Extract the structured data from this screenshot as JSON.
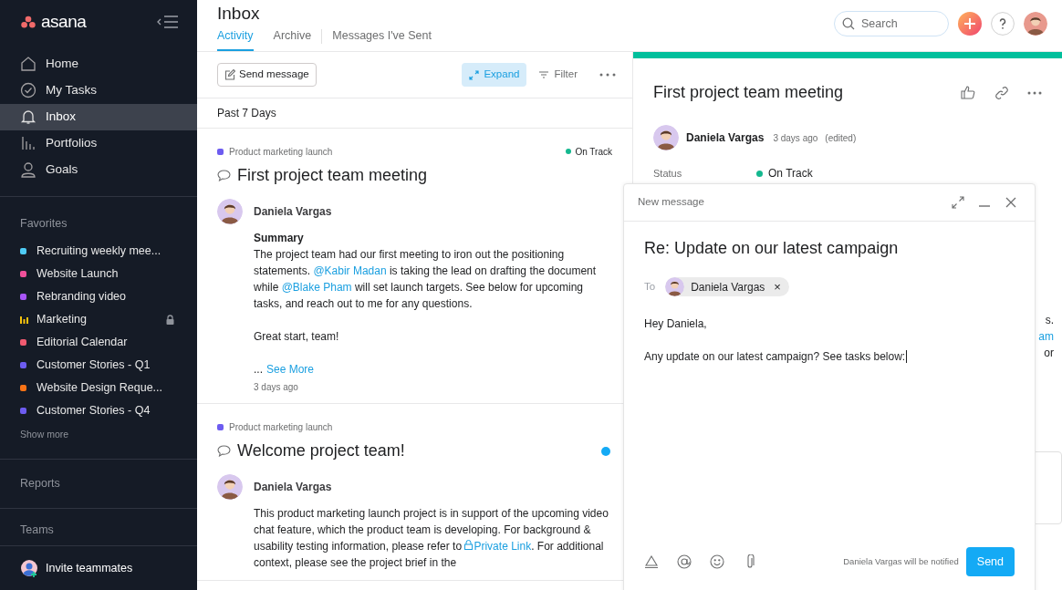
{
  "sidebar": {
    "logo": "asana",
    "nav": [
      {
        "label": "Home",
        "selected": false
      },
      {
        "label": "My Tasks",
        "selected": false
      },
      {
        "label": "Inbox",
        "selected": true
      },
      {
        "label": "Portfolios",
        "selected": false
      },
      {
        "label": "Goals",
        "selected": false
      }
    ],
    "favorites_heading": "Favorites",
    "favorites": [
      {
        "label": "Recruiting weekly mee...",
        "kind": "dot",
        "color": "#4ecbf5",
        "locked": false
      },
      {
        "label": "Website Launch",
        "kind": "dot",
        "color": "#f0509a",
        "locked": false
      },
      {
        "label": "Rebranding video",
        "kind": "dot",
        "color": "#a855f7",
        "locked": false
      },
      {
        "label": "Marketing",
        "kind": "chart",
        "color": "#f8c30d",
        "locked": true
      },
      {
        "label": "Editorial Calendar",
        "kind": "dot",
        "color": "#f05a70",
        "locked": false
      },
      {
        "label": "Customer Stories - Q1",
        "kind": "dot",
        "color": "#6d5cf0",
        "locked": false
      },
      {
        "label": "Website Design Reque...",
        "kind": "dot",
        "color": "#f97316",
        "locked": false
      },
      {
        "label": "Customer Stories - Q4",
        "kind": "dot",
        "color": "#6d5cf0",
        "locked": false
      }
    ],
    "show_more": "Show more",
    "reports": "Reports",
    "teams": "Teams",
    "invite": "Invite teammates"
  },
  "header": {
    "title": "Inbox",
    "tabs": [
      {
        "label": "Activity",
        "selected": true
      },
      {
        "label": "Archive",
        "selected": false
      },
      {
        "label": "Messages I've Sent",
        "selected": false
      }
    ],
    "search": {
      "placeholder": "Search"
    }
  },
  "toolbar": {
    "send_message": "Send message",
    "expand": {
      "label": "Expand",
      "selected": true
    },
    "filter": "Filter"
  },
  "period": "Past 7 Days",
  "feed": [
    {
      "project": "Product marketing launch",
      "status": {
        "label": "On Track",
        "color": "#14b88f"
      },
      "unread": false,
      "title": "First project team meeting",
      "author": "Daniela Vargas",
      "heading": "Summary",
      "paragraphs": [
        [
          {
            "kind": "text",
            "text": "The project team had our first meeting to iron out the positioning statements. "
          },
          {
            "kind": "mention",
            "text": "@Kabir Madan"
          },
          {
            "kind": "text",
            "text": " is taking the lead on drafting the document while "
          },
          {
            "kind": "mention",
            "text": "@Blake Pham"
          },
          {
            "kind": "text",
            "text": " will set launch targets. See below for upcoming tasks, and reach out to me for any questions."
          }
        ],
        [
          {
            "kind": "text",
            "text": "Great start, team!"
          }
        ]
      ],
      "ellipsis": "...",
      "see_more": "See More",
      "time": "3 days ago"
    },
    {
      "project": "Product marketing launch",
      "unread": true,
      "title": "Welcome project team!",
      "author": "Daniela Vargas",
      "paragraphs": [
        [
          {
            "kind": "text",
            "text": "This product marketing launch project is in support of the upcoming video chat feature, which the product team is developing. For background & usability testing information, please refer to "
          },
          {
            "kind": "private_link",
            "text": "Private Link"
          },
          {
            "kind": "text",
            "text": ". For additional context, please see the project brief in the"
          }
        ]
      ]
    }
  ],
  "detail": {
    "title": "First project team meeting",
    "author": "Daniela Vargas",
    "time": "3 days ago",
    "edited": "(edited)",
    "status_label": "Status",
    "status": {
      "label": "On Track",
      "color": "#14b88f"
    },
    "hidden_lines": [
      {
        "kind": "text",
        "text": "s."
      },
      {
        "kind": "mention",
        "text": "am"
      },
      {
        "kind": "text",
        "text": "or"
      }
    ]
  },
  "compose": {
    "heading": "New message",
    "subject": "Re: Update on our latest campaign",
    "to_label": "To",
    "recipient": "Daniela Vargas",
    "remove": "×",
    "body": [
      "Hey Daniela,",
      "Any update on our latest campaign? See tasks below:"
    ],
    "notice": "Daniela Vargas will be notified",
    "send": "Send"
  }
}
